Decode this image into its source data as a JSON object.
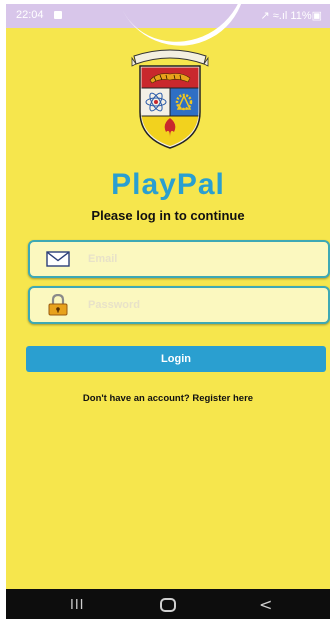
{
  "status_bar": {
    "time": "22:04",
    "battery_text": "↗ ≈.ıl 11%▣"
  },
  "app": {
    "title": "PlayPal",
    "subtitle": "Please log in to continue"
  },
  "form": {
    "email_placeholder": "Email",
    "password_placeholder": "Password",
    "login_label": "Login",
    "register_text": "Don't have an account? Register here"
  },
  "nav_bar": {
    "recents": "III",
    "back": "<"
  },
  "colors": {
    "background": "#f6e64d",
    "accent": "#2a9fd0",
    "field_border": "#3da9b5",
    "status_bar": "#d8c6ea"
  },
  "icons": {
    "email": "envelope-icon",
    "password": "padlock-icon",
    "logo": "crest-logo"
  }
}
